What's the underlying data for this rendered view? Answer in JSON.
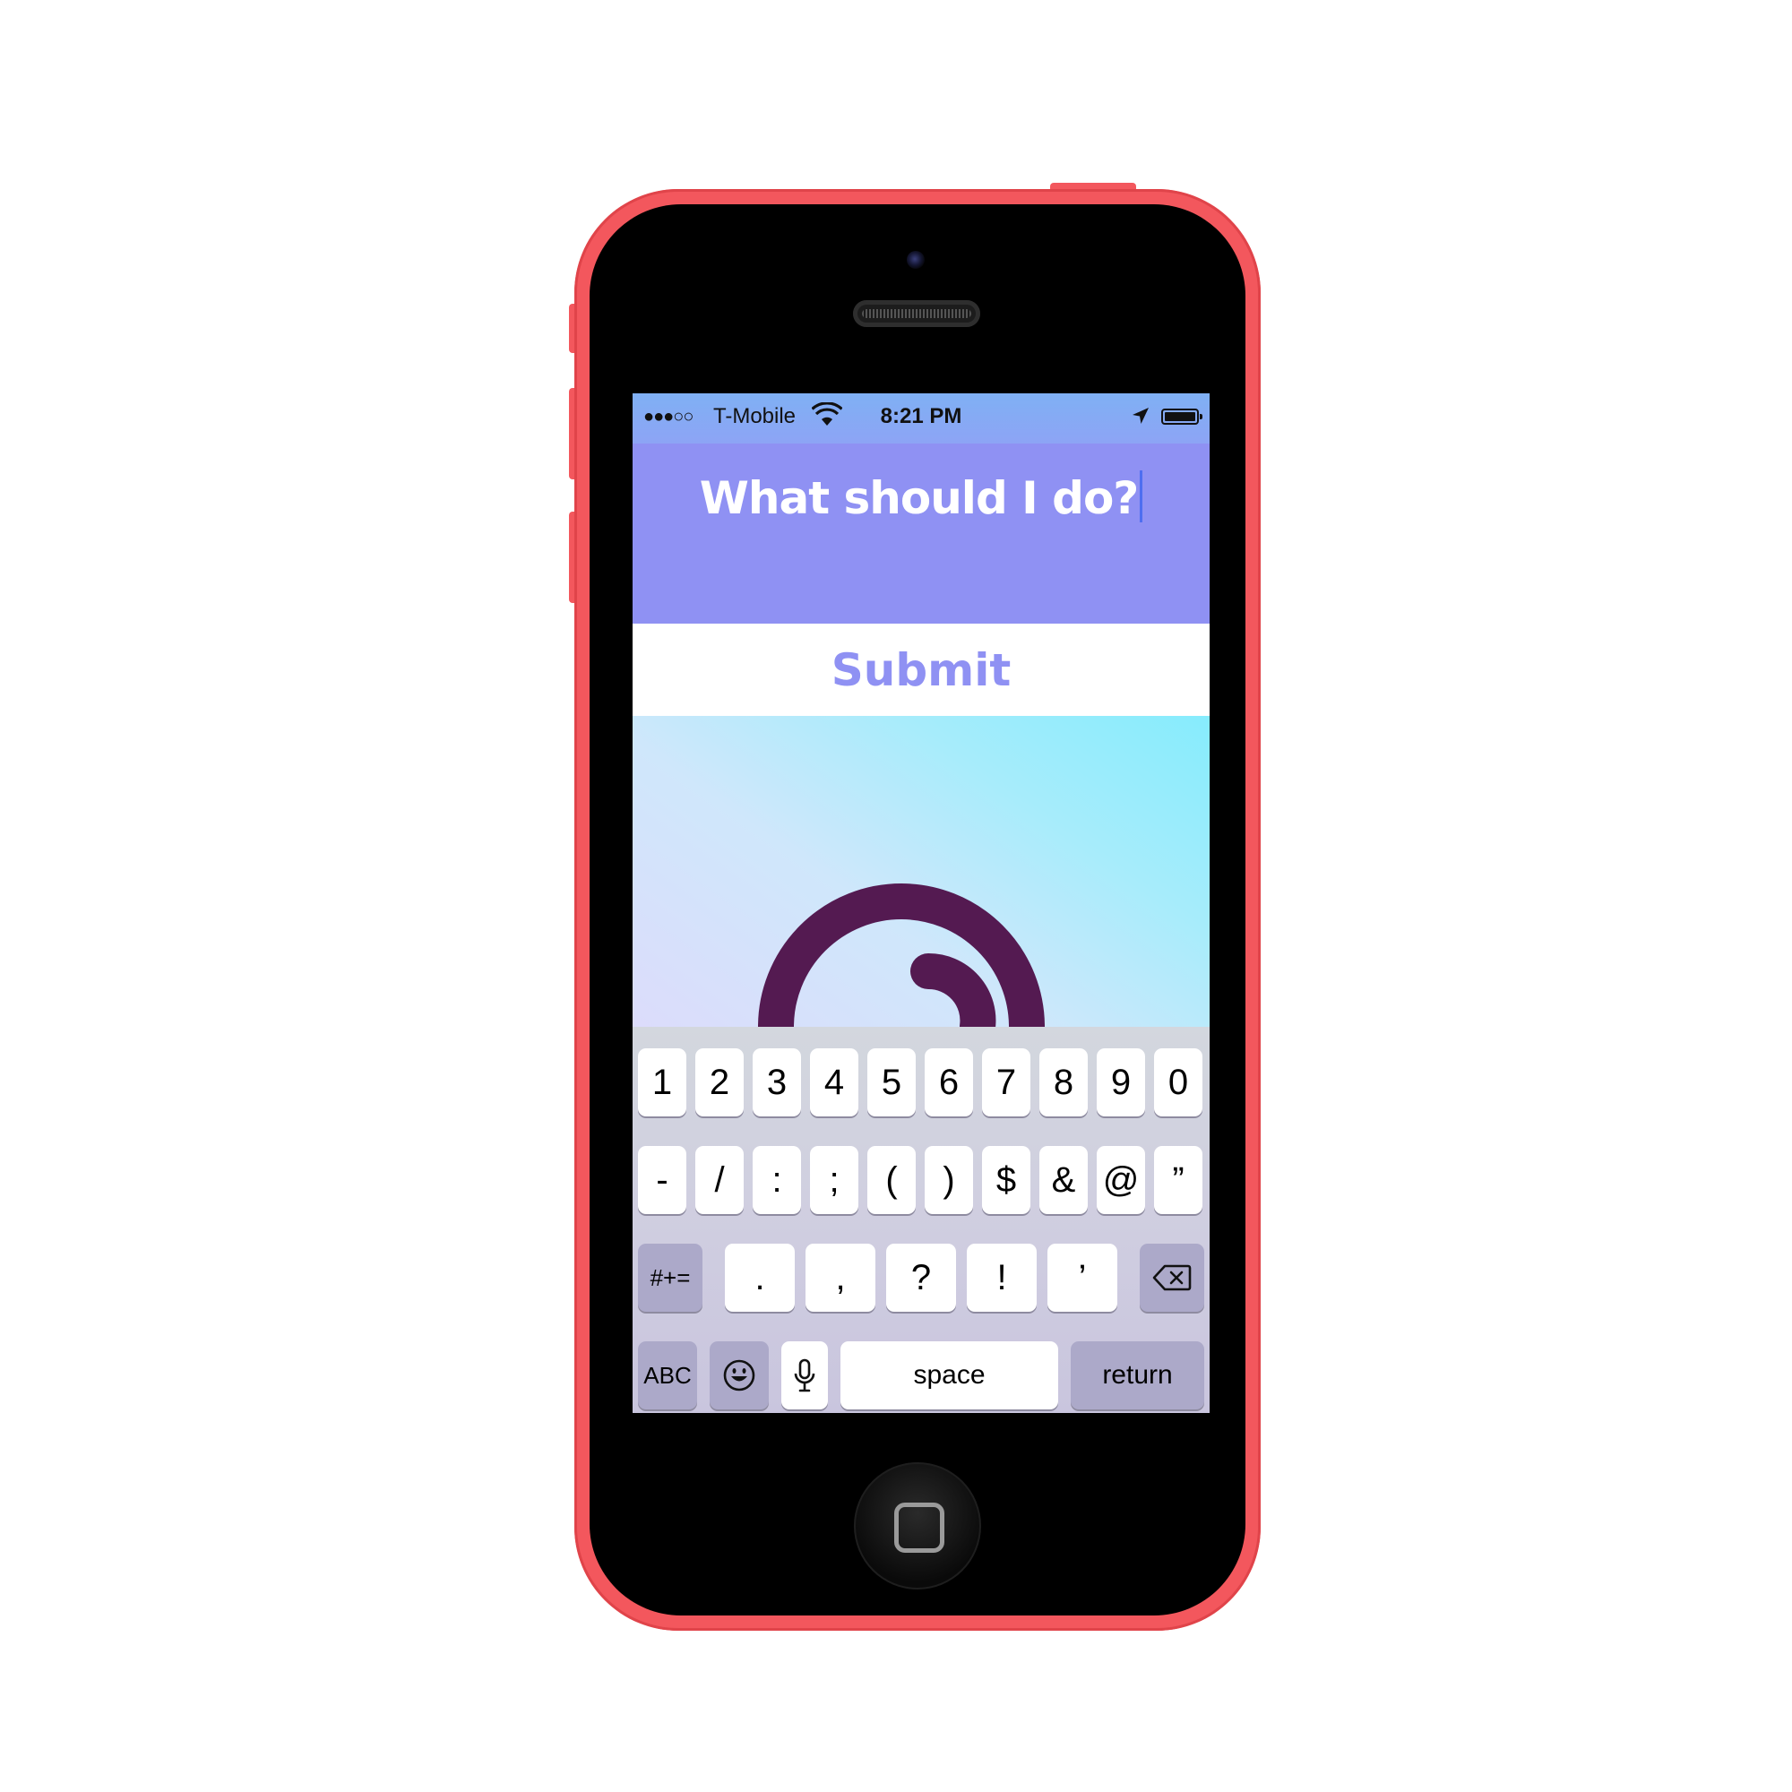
{
  "status_bar": {
    "signal": "●●●○○",
    "carrier": "T-Mobile",
    "time": "8:21 PM"
  },
  "app": {
    "question_input_value": "What should I do?",
    "submit_label": "Submit",
    "colors": {
      "header_bg": "#8f91f3",
      "submit_text": "#8f91f3",
      "spiral": "#541a51",
      "device_shell": "#f3575d"
    }
  },
  "keyboard": {
    "row1": [
      "1",
      "2",
      "3",
      "4",
      "5",
      "6",
      "7",
      "8",
      "9",
      "0"
    ],
    "row2": [
      "-",
      "/",
      ":",
      ";",
      "(",
      ")",
      "$",
      "&",
      "@",
      "”"
    ],
    "row3": [
      ".",
      ",",
      "?",
      "!",
      "’"
    ],
    "shift_label": "#+=",
    "abc_label": "ABC",
    "space_label": "space",
    "return_label": "return",
    "icons": [
      "backspace-icon",
      "emoji-icon",
      "microphone-icon"
    ]
  }
}
